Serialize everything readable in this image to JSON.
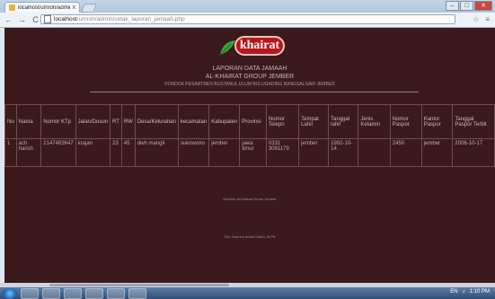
{
  "browser": {
    "tab_title": "localhost/umroh/admin/...",
    "tab_close": "x",
    "url_host": "localhost",
    "url_path": "/umroh/admin/cetak_laporan_jamaah.php",
    "back": "←",
    "forward": "→",
    "reload": "C",
    "star": "☆",
    "menu": "≡",
    "minimize": "–",
    "maximize": "□",
    "close": "✕"
  },
  "report": {
    "logo_text": "khairat",
    "title": "LAPORAN DATA JAMAAH",
    "company": "AL-KHAIRAT GROUP JEMBER",
    "address": "PONDOK PESANTREN BUSTANUL ULUM BULUGADING BANGSALSARI JEMBER",
    "table": {
      "headers": [
        "No",
        "Nama",
        "Nomor KTp",
        "Jalan/Dusun",
        "RT",
        "RW",
        "Desa/Kelurahan",
        "kecamatan",
        "Kabupaten",
        "Provinsi",
        "Nomor Telepn",
        "Tempat Lahir",
        "Tanggal lahir",
        "Jenis Kelamin",
        "Nomor Paspor",
        "Kantor Paspor",
        "Tanggal Paspor Terbit"
      ],
      "rows": [
        [
          "1",
          "ach harish",
          "2147483647",
          "krajan",
          "23",
          "45",
          "dwh mangli",
          "sukowono",
          "jember",
          "jawa timur",
          "0331 3081179",
          "jember",
          "1992-10-14",
          "",
          "2450",
          "jember",
          "2006-10-17"
        ]
      ]
    },
    "footer_org": "Direktur Al-Khairat Group Jember",
    "footer_signatory": "Drs. Dzunun Abdul Karim, M.Pd"
  },
  "taskbar": {
    "clock": "1:10 PM",
    "tray_lang": "EN"
  },
  "colors": {
    "page_bg": "#3b1a1e",
    "logo_red": "#b8151c",
    "leaf_green": "#3aa63a"
  }
}
